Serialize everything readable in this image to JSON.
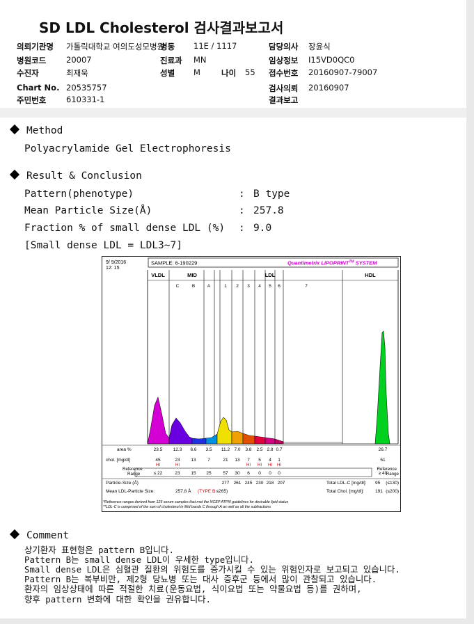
{
  "title": "SD LDL Cholesterol 검사결과보고서",
  "header": {
    "institution_label": "의뢰기관명",
    "institution_value": "가톨릭대학교 여의도성모병원",
    "ward_label": "병동",
    "ward_value": "11E / 1117",
    "doctor_label": "담당의사",
    "doctor_value": "장윤식",
    "hospital_code_label": "병원코드",
    "hospital_code_value": "20007",
    "dept_label": "진료과",
    "dept_value": "MN",
    "clinical_label": "임상정보",
    "clinical_value": "I15VD0QC0",
    "patient_label": "수진자",
    "patient_value": "최재욱",
    "sex_label": "성별",
    "sex_value": "M",
    "age_label": "나이",
    "age_value": "55",
    "receipt_label": "접수번호",
    "receipt_value": "20160907-79007",
    "chart_label": "Chart No.",
    "chart_value": "20535757",
    "request_label": "검사의뢰",
    "request_value": "20160907",
    "id_label": "주민번호",
    "id_value": "610331-1",
    "result_label": "결과보고",
    "result_value": ""
  },
  "method": {
    "heading": "Method",
    "text": "Polyacrylamide Gel Electrophoresis"
  },
  "result": {
    "heading": "Result & Conclusion",
    "rows": [
      {
        "label": "Pattern(phenotype)",
        "colon": ":",
        "value": "B type"
      },
      {
        "label": "Mean Particle Size(Å)",
        "colon": ":",
        "value": "257.8"
      },
      {
        "label": "Fraction % of small dense LDL (%)",
        "colon": ":",
        "value": "9.0"
      }
    ],
    "note": "[Small dense LDL = LDL3~7]"
  },
  "comment": {
    "heading": "Comment",
    "lines": [
      "상기환자 표현형은 pattern B입니다.",
      "Pattern B는 small dense LDL이 우세한 type입니다.",
      "Small dense LDL은 심혈관 질환의 위험도를 증가시킬 수 있는 위험인자로 보고되고 있습니다.",
      "Pattern B는 복부비만, 제2형 당뇨병 또는 대사 증후군 등에서 많이 관찰되고 있습니다.",
      "환자의 임상상태에 따른 적절한 치료(운동요법, 식이요법 또는 약물요법 등)를 권하며,",
      "향후 pattern 변화에 대한 확인을 권유합니다."
    ]
  },
  "chart_data": {
    "type": "area",
    "date": "9/ 9/2016",
    "time": "12: 15",
    "sample": "SAMPLE:  6-190229",
    "brand": "Quantimetrix LIPOPRINT",
    "brand_tm": "TM",
    "brand_suffix": " SYSTEM",
    "group_labels": {
      "vldl": "VLDL",
      "mid": "MID",
      "ldl": "LDL",
      "hdl": "HDL"
    },
    "bands": [
      "VLDL",
      "C",
      "B",
      "A",
      "1",
      "2",
      "3",
      "4",
      "5",
      "6",
      "7",
      "HDL"
    ],
    "band_labels": [
      "C",
      "B",
      "A",
      "1",
      "2",
      "3",
      "4",
      "5",
      "6",
      "7"
    ],
    "area_label": "area %",
    "area": [
      "23.5",
      "12.3",
      "6.6",
      "3.5",
      "11.2",
      "7.0",
      "3.8",
      "2.5",
      "2.8",
      "0.7",
      "",
      "26.7"
    ],
    "chol_label": "chol. [mg/dl]",
    "chol": [
      "45",
      "23",
      "13",
      "7",
      "21",
      "13",
      "7",
      "5",
      "4",
      "1",
      "",
      "51"
    ],
    "hi_flags": [
      "HI",
      "HI",
      "",
      "",
      "",
      "",
      "HI",
      "HI",
      "HI",
      "HI",
      "",
      ""
    ],
    "ref_label_1": "Reference",
    "ref_label_2": "Range",
    "ref": [
      "≤ 22",
      "23",
      "15",
      "25",
      "57",
      "30",
      "6",
      "0",
      "0",
      "0",
      "",
      "≥ 40"
    ],
    "ref_right_1": "Reference",
    "ref_right_2": "Range",
    "particle_label": "Particle-Size (Å)",
    "particle": [
      "277",
      "261",
      "245",
      "230",
      "218",
      "207"
    ],
    "total_ldl_label": "Total LDL-C [mg/dl]:",
    "total_ldl_value": "95",
    "total_ldl_ref": "(≤130)",
    "total_chol_label": "Total Chol. [mg/dl]:",
    "total_chol_value": "191",
    "total_chol_ref": "(≤200)",
    "mean_size_label": "Mean LDL-Particle Size:",
    "mean_size_value": "257.8 Å",
    "type_label": "(TYPE B",
    "type_ref": "; ≤265)",
    "footnote_1": "*Reference ranges derived from 125 serum samples that met the NCEP ATPIII guidelines for desirable lipid status",
    "footnote_2": "**LDL-C is comprised of the sum of cholesterol in Mid bands C through A as well as all the subfractions",
    "colors": {
      "vldl": "#d400d4",
      "c": "#6a00e0",
      "b": "#2030e0",
      "a": "#0090e0",
      "l1": "#f0e000",
      "l2": "#f0a000",
      "l3": "#e05000",
      "l4": "#e00040",
      "l5": "#d00080",
      "l6": "#c00060",
      "hdl": "#00d020",
      "hi": "#e00000",
      "brand": "#cc00cc"
    }
  }
}
